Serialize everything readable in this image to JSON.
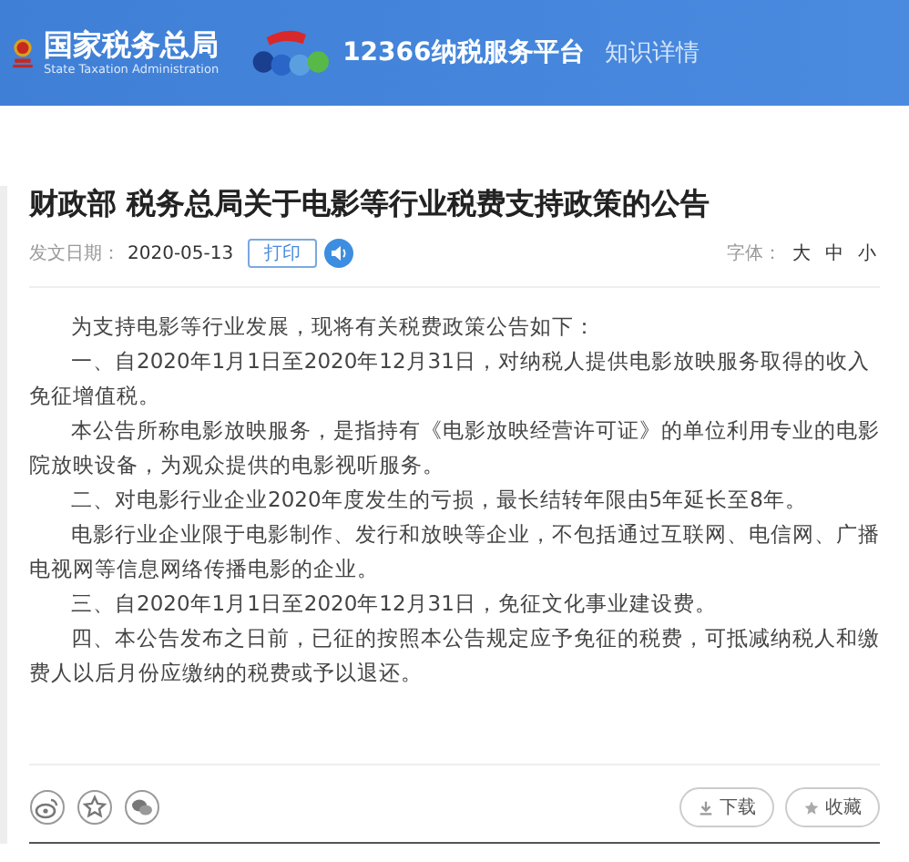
{
  "header": {
    "agency_name": "国家税务总局",
    "agency_name_en": "State Taxation Administration",
    "platform_name": "12366纳税服务平台",
    "section": "知识详情"
  },
  "article": {
    "title": "财政部 税务总局关于电影等行业税费支持政策的公告",
    "date_label": "发文日期：",
    "date": "2020-05-13",
    "print_button": "打印",
    "font_label": "字体：",
    "font_sizes": [
      {
        "label": "大",
        "selected": false
      },
      {
        "label": "中",
        "selected": false
      },
      {
        "label": "小",
        "selected": false
      }
    ],
    "paragraphs": [
      "为支持电影等行业发展，现将有关税费政策公告如下：",
      "一、自2020年1月1日至2020年12月31日，对纳税人提供电影放映服务取得的收入免征增值税。",
      "本公告所称电影放映服务，是指持有《电影放映经营许可证》的单位利用专业的电影院放映设备，为观众提供的电影视听服务。",
      "二、对电影行业企业2020年度发生的亏损，最长结转年限由5年延长至8年。",
      "电影行业企业限于电影制作、发行和放映等企业，不包括通过互联网、电信网、广播电视网等信息网络传播电影的企业。",
      "三、自2020年1月1日至2020年12月31日，免征文化事业建设费。",
      "四、本公告发布之日前，已征的按照本公告规定应予免征的税费，可抵减纳税人和缴费人以后月份应缴纳的税费或予以退还。"
    ]
  },
  "footer": {
    "share": [
      {
        "kind": "weibo"
      },
      {
        "kind": "star"
      },
      {
        "kind": "wechat"
      }
    ],
    "actions": [
      {
        "kind": "download",
        "label": "下载"
      },
      {
        "kind": "favorite",
        "label": "收藏"
      }
    ]
  }
}
